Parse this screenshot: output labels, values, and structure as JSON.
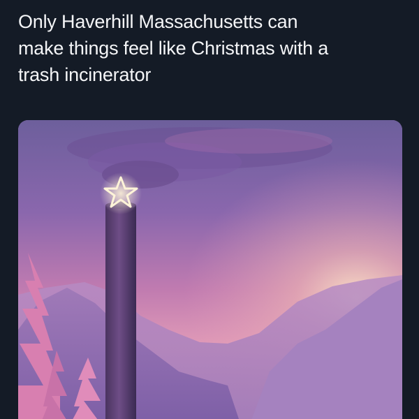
{
  "post": {
    "text_lines": [
      "Only Haverhill Massachusetts can",
      "make things feel like Christmas with a",
      "trash incinerator"
    ]
  },
  "colors": {
    "background": "#141b26",
    "text": "#f4f5f7",
    "sky_purple": "#8a67ad",
    "sunset_pink": "#e7a0b8",
    "sunset_glow": "#f7dcc0",
    "mountain_violet": "#a178b8",
    "tree_pink": "#d87fb0",
    "star_glow": "#fff4d8"
  },
  "media": {
    "content": "painting of an incinerator smokestack topped with a lit star at sunset among purple mountains and pink pine trees",
    "icons": [
      "star-light-icon"
    ]
  }
}
